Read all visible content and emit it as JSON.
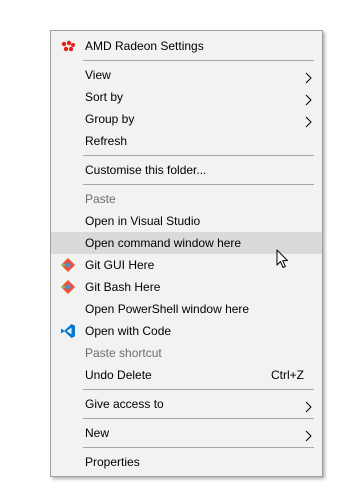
{
  "menu": {
    "amd_radeon_settings": "AMD Radeon Settings",
    "view": "View",
    "sort_by": "Sort by",
    "group_by": "Group by",
    "refresh": "Refresh",
    "customise_folder": "Customise this folder...",
    "paste": "Paste",
    "open_in_visual_studio": "Open in Visual Studio",
    "open_command_window": "Open command window here",
    "git_gui_here": "Git GUI Here",
    "git_bash_here": "Git Bash Here",
    "open_powershell_window": "Open PowerShell window here",
    "open_with_code": "Open with Code",
    "paste_shortcut": "Paste shortcut",
    "undo_delete": "Undo Delete",
    "undo_delete_shortcut": "Ctrl+Z",
    "give_access_to": "Give access to",
    "new": "New",
    "properties": "Properties"
  },
  "state": {
    "hovered_item": "Open command window here",
    "disabled_items": [
      "Paste",
      "Paste shortcut"
    ]
  },
  "icons": {
    "amd_radeon_settings": "amd-radeon-icon",
    "git_gui_here": "git-icon",
    "git_bash_here": "git-icon",
    "open_with_code": "vscode-icon",
    "submenu_arrow": "chevron-right-icon",
    "cursor": "mouse-pointer-icon"
  },
  "colors": {
    "menu_background": "#f2f2f2",
    "hover_highlight": "#dadada",
    "disabled_text": "#6d6d6d",
    "amd_red": "#e2231a",
    "git_orange": "#f05033",
    "vscode_blue": "#0078d4"
  }
}
